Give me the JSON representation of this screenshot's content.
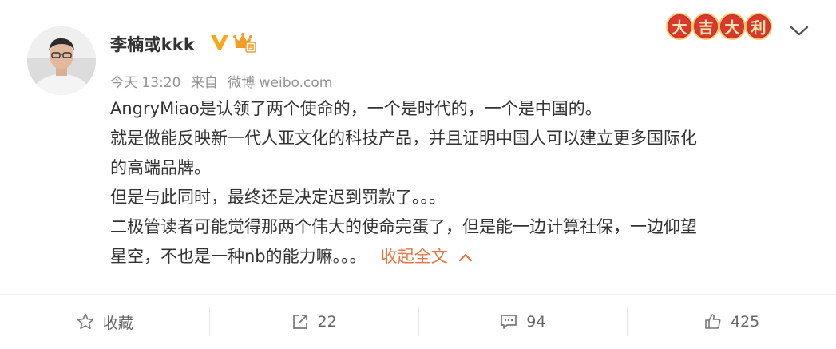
{
  "post": {
    "author": "李楠或kkk",
    "meta": {
      "time": "今天 13:20",
      "source_prefix": "来自",
      "source": "微博 weibo.com"
    },
    "badge_chars": [
      "大",
      "吉",
      "大",
      "利"
    ],
    "content": {
      "line1": "AngryMiao是认领了两个使命的，一个是时代的，一个是中国的。",
      "line2": "就是做能反映新一代人亚文化的科技产品，并且证明中国人可以建立更多国际化",
      "line3": "的高端品牌。",
      "line4": "但是与此同时，最终还是决定迟到罚款了。。。",
      "line5": "二极管读者可能觉得那两个伟大的使命完蛋了，但是能一边计算社保，一边仰望",
      "line6": "星空，不也是一种nb的能力嘛。。。"
    },
    "collapse_label": "收起全文"
  },
  "actions": {
    "favorite": "收藏",
    "repost": "22",
    "comment": "94",
    "like": "425"
  },
  "icons": [
    "avatar",
    "vip-icon",
    "crown-icon",
    "chevron-down-icon",
    "chevron-up-icon",
    "star-icon",
    "share-icon",
    "comment-icon",
    "thumbs-up-icon"
  ],
  "colors": {
    "accent": "#eb7340",
    "vip": "#f7a91b",
    "text": "#333333",
    "muted": "#939393"
  }
}
